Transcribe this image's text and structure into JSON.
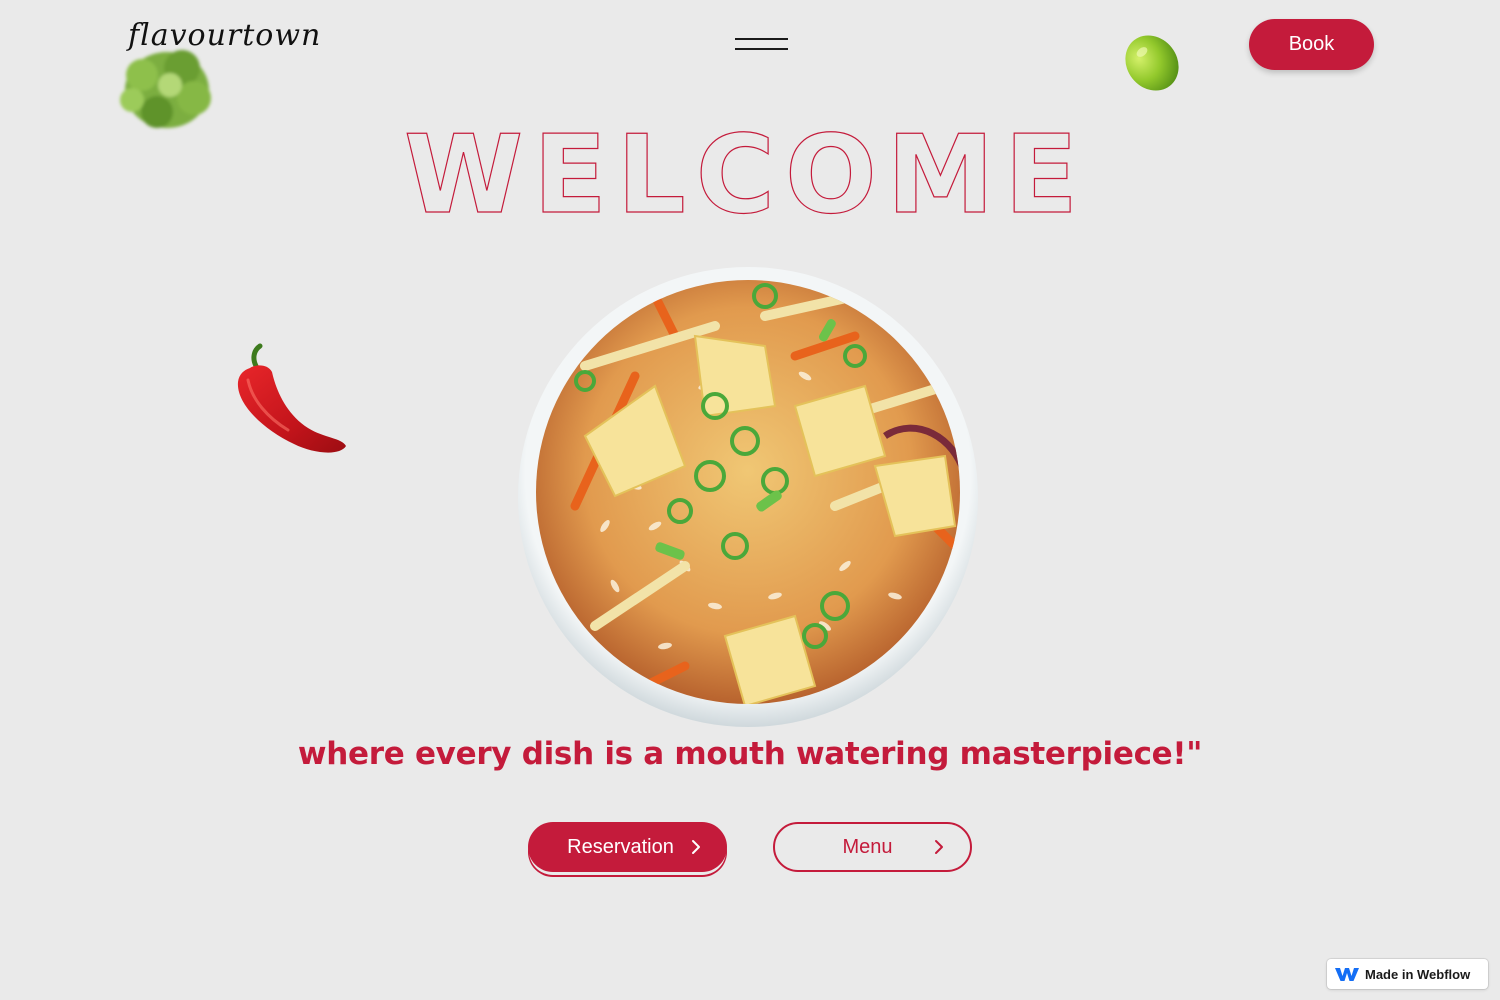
{
  "header": {
    "logo_text": "flavourtown",
    "book_label": "Book"
  },
  "hero": {
    "heading": "WELCOME",
    "tagline": "where every dish is a mouth watering masterpiece!\""
  },
  "actions": {
    "reservation_label": "Reservation",
    "menu_label": "Menu"
  },
  "badge": {
    "label": "Made in Webflow"
  },
  "icons": {
    "menu": "hamburger-menu-icon",
    "chevron": "chevron-right-icon",
    "webflow": "webflow-logo-icon"
  },
  "colors": {
    "background": "#eaeaea",
    "accent": "#c41b3b",
    "text_dark": "#111111"
  }
}
